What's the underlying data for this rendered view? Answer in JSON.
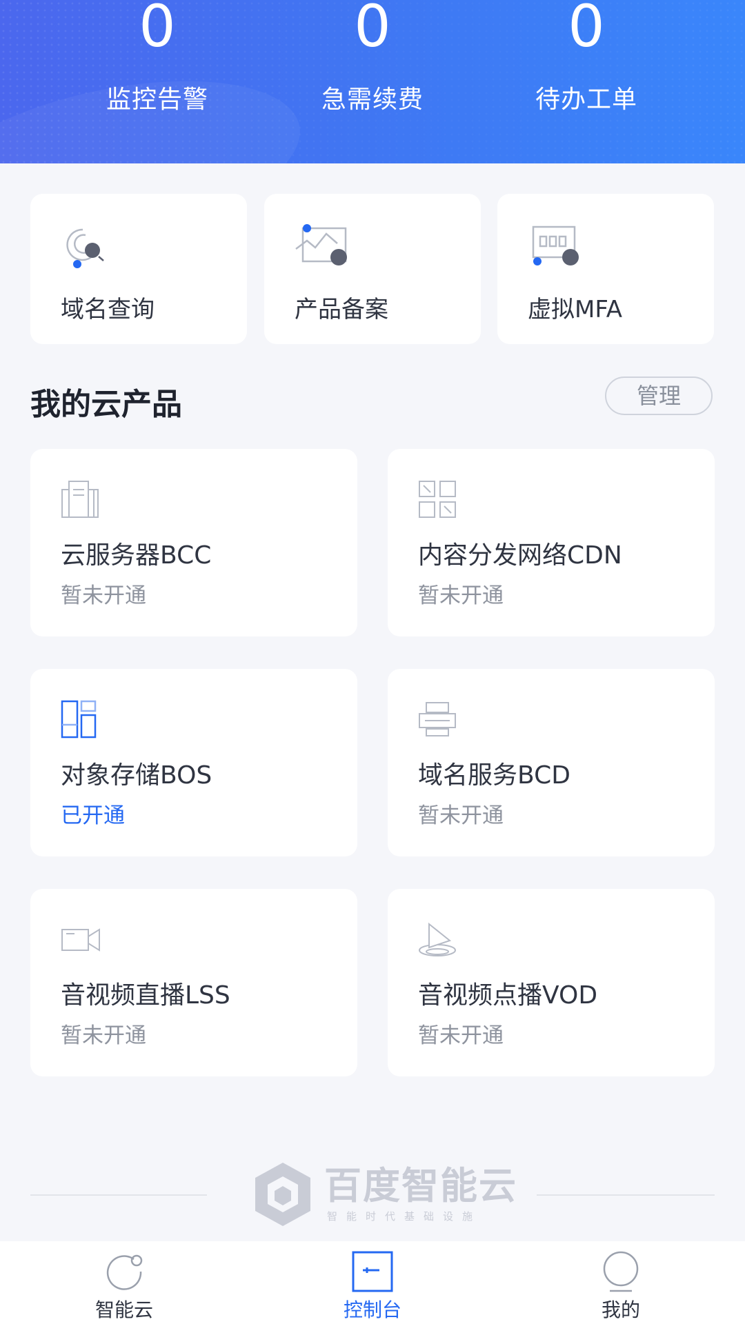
{
  "stats": [
    {
      "value": "0",
      "label": "监控告警"
    },
    {
      "value": "0",
      "label": "急需续费"
    },
    {
      "value": "0",
      "label": "待办工单"
    }
  ],
  "tools": [
    {
      "label": "域名查询",
      "icon": "domain-search-icon"
    },
    {
      "label": "产品备案",
      "icon": "product-filing-icon"
    },
    {
      "label": "虚拟MFA",
      "icon": "virtual-mfa-icon"
    }
  ],
  "products_section": {
    "title": "我的云产品",
    "manage_label": "管理"
  },
  "products": [
    {
      "name": "云服务器BCC",
      "status": "暂未开通",
      "icon": "server-icon"
    },
    {
      "name": "内容分发网络CDN",
      "status": "暂未开通",
      "icon": "grid-network-icon"
    },
    {
      "name": "对象存储BOS",
      "status": "已开通",
      "icon": "storage-blocks-icon"
    },
    {
      "name": "域名服务BCD",
      "status": "暂未开通",
      "icon": "domain-service-icon"
    },
    {
      "name": "音视频直播LSS",
      "status": "暂未开通",
      "icon": "video-camera-icon"
    },
    {
      "name": "音视频点播VOD",
      "status": "暂未开通",
      "icon": "play-icon"
    }
  ],
  "brand": {
    "name": "百度智能云",
    "slogan": "智能时代基础设施"
  },
  "tabs": [
    {
      "label": "智能云",
      "icon": "cloud-home-icon",
      "active": false
    },
    {
      "label": "控制台",
      "icon": "console-icon",
      "active": true
    },
    {
      "label": "我的",
      "icon": "profile-icon",
      "active": false
    }
  ],
  "colors": {
    "header_gradient_start": "#4b67ee",
    "header_gradient_end": "#3a86fb",
    "accent": "#2468f2",
    "page_bg": "#f5f6fa",
    "status_off": "#8e939e"
  }
}
